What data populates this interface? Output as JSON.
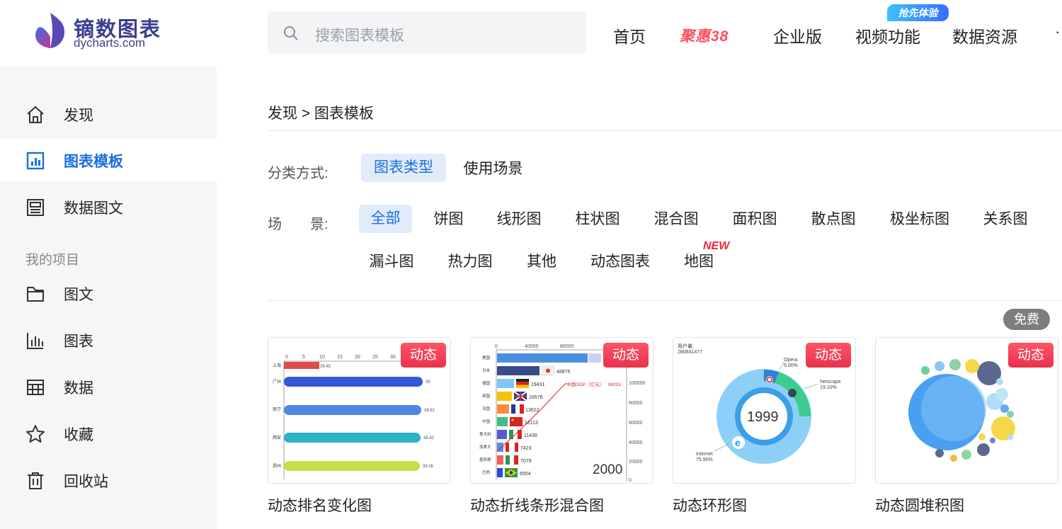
{
  "brand": {
    "name_cn": "镝数图表",
    "name_en": "dycharts.com"
  },
  "search": {
    "placeholder": "搜索图表模板"
  },
  "nav": {
    "items": [
      "首页",
      "企业版",
      "视频功能",
      "数据资源"
    ],
    "promo": "聚惠38",
    "badge": "抢先体验",
    "more": "·"
  },
  "sidebar": {
    "items": [
      {
        "label": "发现",
        "icon": "home-icon"
      },
      {
        "label": "图表模板",
        "icon": "chart-template-icon"
      },
      {
        "label": "数据图文",
        "icon": "article-icon"
      }
    ],
    "section_title": "我的项目",
    "project_items": [
      {
        "label": "图文",
        "icon": "folder-icon"
      },
      {
        "label": "图表",
        "icon": "bar-chart-icon"
      },
      {
        "label": "数据",
        "icon": "table-icon"
      },
      {
        "label": "收藏",
        "icon": "star-icon"
      },
      {
        "label": "回收站",
        "icon": "trash-icon"
      }
    ],
    "active": "图表模板"
  },
  "breadcrumb": "发现 > 图表模板",
  "filters": {
    "method_label": "分类方式:",
    "methods": [
      "图表类型",
      "使用场景"
    ],
    "active_method": "图表类型",
    "scene_label": "场　　景:",
    "types_row1": [
      "全部",
      "饼图",
      "线形图",
      "柱状图",
      "混合图",
      "面积图",
      "散点图",
      "极坐标图",
      "关系图"
    ],
    "types_row2": [
      "漏斗图",
      "热力图",
      "其他",
      "动态图表",
      "地图"
    ],
    "active_type": "全部",
    "new_tag": "NEW"
  },
  "cards": [
    {
      "title": "动态排名变化图",
      "badge": "动态"
    },
    {
      "title": "动态折线条形混合图",
      "badge": "动态"
    },
    {
      "title": "动态环形图",
      "badge": "动态"
    },
    {
      "title": "动态圆堆积图",
      "badge": "动态",
      "free": "免费"
    }
  ],
  "thumbs": {
    "rank": {
      "ticks": [
        "0",
        "5",
        "10",
        "15",
        "20",
        "25",
        "30"
      ],
      "rows": [
        {
          "name": "上海",
          "value": "39.45"
        },
        {
          "name": "广州",
          "value": "39"
        },
        {
          "name": "南宁",
          "value": "38.61"
        },
        {
          "name": "西安",
          "value": "38.42"
        },
        {
          "name": "郑州",
          "value": "38.08"
        }
      ],
      "colors": [
        "#e04b4b",
        "#3557d6",
        "#4e86e8",
        "#2bb3c6",
        "#c4e04a"
      ]
    },
    "gdp": {
      "ticks": [
        "0",
        "40000",
        "80000"
      ],
      "right_ticks": [
        "100000",
        "80000",
        "60000",
        "40000",
        "20000",
        "0"
      ],
      "rows": [
        {
          "name": "美国",
          "value": ""
        },
        {
          "name": "日本",
          "value": "48875"
        },
        {
          "name": "德国",
          "value": "19431"
        },
        {
          "name": "英国",
          "value": "16578"
        },
        {
          "name": "法国",
          "value": "13622"
        },
        {
          "name": "中国",
          "value": "12113"
        },
        {
          "name": "意大利",
          "value": "11438"
        },
        {
          "name": "加拿大",
          "value": "7423"
        },
        {
          "name": "墨西哥",
          "value": "7079"
        },
        {
          "name": "巴西",
          "value": "6554"
        }
      ],
      "line_label": "中国GDP（亿元）",
      "line_value": "99231",
      "year": "2000"
    },
    "donut": {
      "header": "用户量:",
      "header_value": "280841477",
      "year": "1999",
      "labels": [
        {
          "name": "Opera",
          "pct": "5.00%"
        },
        {
          "name": "Netscape",
          "pct": "19.10%"
        },
        {
          "name": "Internet",
          "pct": "75.90%"
        }
      ]
    }
  }
}
